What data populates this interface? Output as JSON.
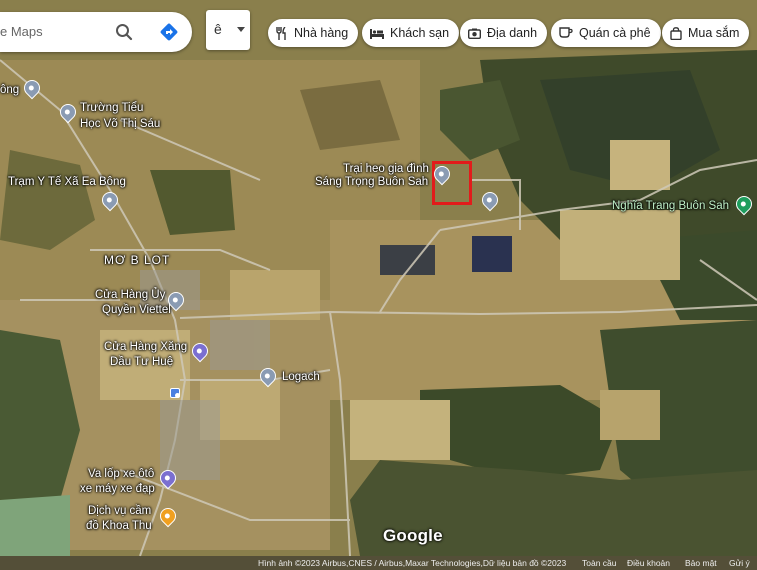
{
  "search": {
    "placeholder": "e Maps"
  },
  "language_button": {
    "label": "ê"
  },
  "chips": [
    {
      "label": "Nhà hàng",
      "icon": "fork-knife-icon"
    },
    {
      "label": "Khách sạn",
      "icon": "bed-icon"
    },
    {
      "label": "Địa danh",
      "icon": "camera-icon"
    },
    {
      "label": "Quán cà phê",
      "icon": "coffee-icon"
    },
    {
      "label": "Mua sắm",
      "icon": "shopping-bag-icon"
    }
  ],
  "places": {
    "ong": "ông",
    "truong_line1": "Trường Tiểu",
    "truong_line2": "Học Võ Thị Sáu",
    "tram_y_te": "Trạm Y Tế Xã Ea Bông",
    "trai_heo_line1": "Trại heo gia đình",
    "trai_heo_line2": "Sáng Trọng Buôn Sah",
    "nghia_trang": "Nghĩa Trang Buôn Sah",
    "mo_b_lot": "MƠ B LOT",
    "viettel_line1": "Cửa Hàng Ủy",
    "viettel_line2": "Quyền Viettel",
    "xang_dau_line1": "Cửa Hàng Xăng",
    "xang_dau_line2": "Dầu Tư Huệ",
    "logach": "Logach",
    "xe_line1": "Va lốp xe ôtô",
    "xe_line2": "xe máy xe đạp",
    "dich_vu_line1": "Dịch vụ cầm",
    "dich_vu_line2": "đồ Khoa Thu"
  },
  "watermark": "Google",
  "footer": {
    "attribution": "Hình ảnh ©2023 Airbus,CNES / Airbus,Maxar Technologies,Dữ liệu bản đồ ©2023",
    "global": "Toàn cầu",
    "terms": "Điều khoản",
    "privacy": "Bảo mật",
    "feedback": "Gửi ý"
  },
  "colors": {
    "highlight_box": "#e21b1b",
    "chip_bg": "#ffffff",
    "pin_default": "#8a9bb3"
  }
}
